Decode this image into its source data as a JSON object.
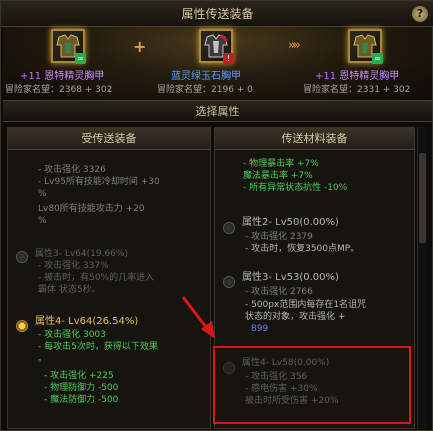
{
  "window": {
    "title": "属性传送装备",
    "help_label": "?"
  },
  "transfer": {
    "source": {
      "level": "+11",
      "name": "恩特精灵胸甲",
      "renown_label": "冒险家名望：",
      "renown": "2368 + 302",
      "icon": "chest-armor-icon"
    },
    "material": {
      "name": "蓝灵绿玉石胸甲",
      "renown_label": "冒险家名望：",
      "renown": "2196 + 0",
      "icon": "jade-chest-armor-icon"
    },
    "result": {
      "level": "+11",
      "name": "恩特精灵胸甲",
      "renown_label": "冒险家名望：",
      "renown": "2331 + 302",
      "icon": "chest-armor-icon"
    },
    "plus_symbol": "+",
    "arrow_symbol": "»»"
  },
  "section_title": "选择属性",
  "left_panel": {
    "title": "受传送装备",
    "lines": [
      "- 攻击强化 3326",
      "- Lv95所有技能冷却时间 +30",
      "%",
      "Lv80所有技能攻击力 +20",
      "%",
      "属性3- Lv64(19.66%)",
      "- 攻击强化 337%",
      "- 被击时，有50%的几率进入",
      "  霸体 状态5秒。",
      "属性4- Lv64(26.54%)",
      "- 攻击强化 3003",
      "- 每攻击5次时，获得以下效果",
      "。",
      "- 攻击强化 +225",
      "- 物理防御力 -500",
      "- 魔法防御力 -500"
    ]
  },
  "right_panel": {
    "title": "传送材料装备",
    "lines": [
      "- 物理暴击率 +7%",
      "  魔法暴击率 +7%",
      "- 所有异常状态抗性 -10%",
      "属性2- Lv50(0.00%)",
      "- 攻击强化 2379",
      "- 攻击时，恢复3500点MP。",
      "属性3- Lv53(0.00%)",
      "- 攻击强化 2766",
      "- 500px范围内每存在1名诅咒",
      "  状态的对象，攻击强化 +",
      "899",
      "属性4- Lv58(0.00%)",
      "- 攻击强化 356",
      "- 感电伤害 +30%",
      "  被击时所受伤害 +20%"
    ]
  },
  "colors": {
    "highlight_box": "#d81818",
    "selected_attr": "#4ecb4e",
    "gold": "#e6c24a"
  }
}
